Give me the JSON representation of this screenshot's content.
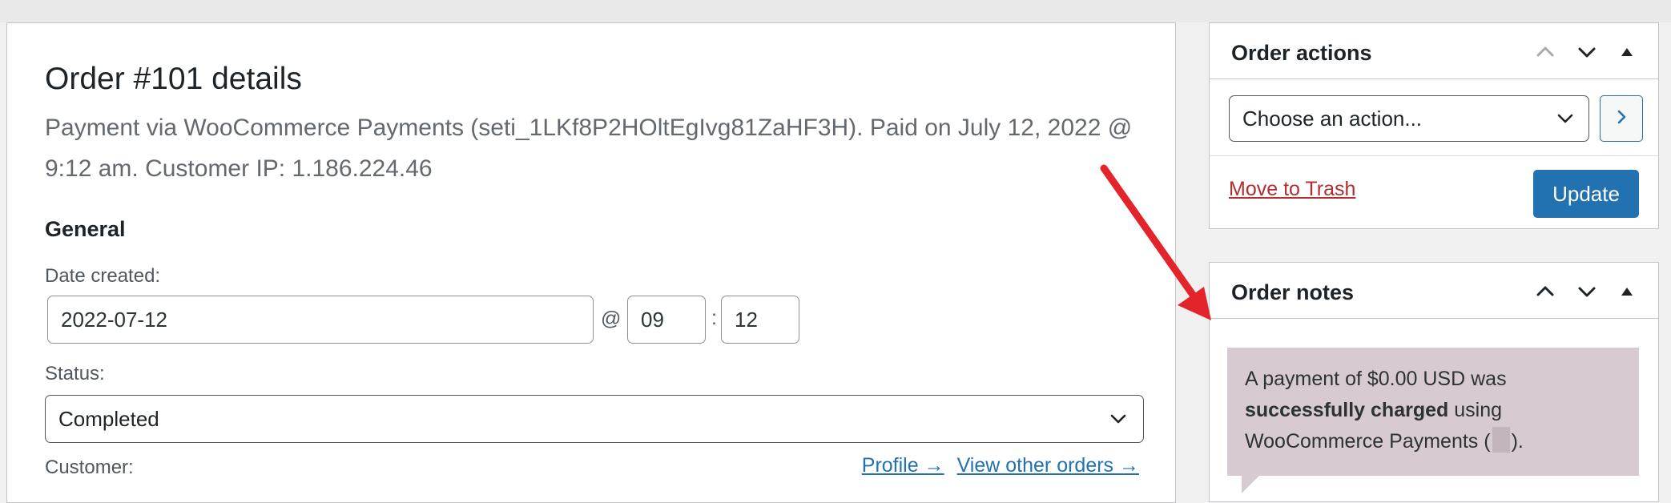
{
  "order": {
    "title": "Order #101 details",
    "meta": "Payment via WooCommerce Payments (seti_1LKf8P2HOltEgIvg81ZaHF3H). Paid on July 12, 2022 @ 9:12 am. Customer IP: 1.186.224.46"
  },
  "general": {
    "heading": "General",
    "date_label": "Date created:",
    "date_value": "2022-07-12",
    "at": "@",
    "hour_value": "09",
    "colon": ":",
    "minute_value": "12",
    "status_label": "Status:",
    "status_value": "Completed",
    "customer_label": "Customer:",
    "profile_link": "Profile →",
    "other_orders_link": "View other orders →"
  },
  "order_actions": {
    "title": "Order actions",
    "select_value": "Choose an action...",
    "trash_link": "Move to Trash",
    "update_button": "Update"
  },
  "order_notes": {
    "title": "Order notes",
    "note_part1": "A payment of $0.00 USD was ",
    "note_bold": "successfully charged",
    "note_part2": " using WooCommerce Payments (",
    "note_part3": ")."
  },
  "colors": {
    "primary": "#2271b1",
    "danger": "#b32d2e",
    "note_bg": "#d7cad2",
    "annotation_arrow": "#e3242b"
  },
  "icons": {
    "select_caret": "chevron-down-icon",
    "go": "chevron-right-icon",
    "move_up": "chevron-up-icon",
    "move_down": "chevron-down-icon",
    "toggle": "triangle-up-icon",
    "annotation": "red-arrow-icon"
  }
}
